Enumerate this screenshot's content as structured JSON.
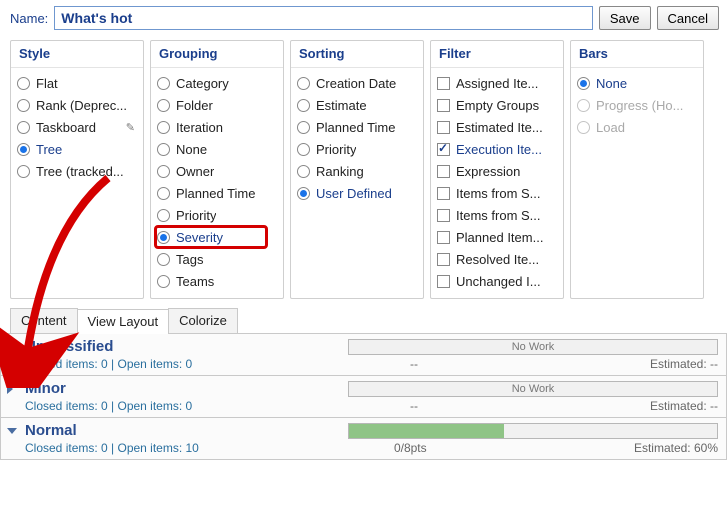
{
  "name_label": "Name:",
  "name_value": "What's hot",
  "save_label": "Save",
  "cancel_label": "Cancel",
  "cols": {
    "style": {
      "title": "Style",
      "opts": [
        "Flat",
        "Rank (Deprec...",
        "Taskboard",
        "Tree",
        "Tree (tracked..."
      ],
      "selected": 3
    },
    "grouping": {
      "title": "Grouping",
      "opts": [
        "Category",
        "Folder",
        "Iteration",
        "None",
        "Owner",
        "Planned Time",
        "Priority",
        "Severity",
        "Tags",
        "Teams"
      ],
      "selected": 7
    },
    "sorting": {
      "title": "Sorting",
      "opts": [
        "Creation Date",
        "Estimate",
        "Planned Time",
        "Priority",
        "Ranking",
        "User Defined"
      ],
      "selected": 5
    },
    "filter": {
      "title": "Filter",
      "opts": [
        "Assigned Ite...",
        "Empty Groups",
        "Estimated Ite...",
        "Execution Ite...",
        "Expression",
        "Items from S...",
        "Items from S...",
        "Planned Item...",
        "Resolved Ite...",
        "Unchanged I..."
      ],
      "checked": [
        3
      ]
    },
    "bars": {
      "title": "Bars",
      "opts": [
        "None",
        "Progress (Ho...",
        "Load"
      ],
      "selected": 0,
      "disabled": [
        1,
        2
      ]
    }
  },
  "tabs": [
    "Content",
    "View Layout",
    "Colorize"
  ],
  "active_tab": 1,
  "groups": [
    {
      "title": "Unclassified",
      "closed": 0,
      "open": 0,
      "bar_text": "No Work",
      "bar_fill": 0,
      "pts": "--",
      "est": "Estimated: --"
    },
    {
      "title": "Minor",
      "closed": 0,
      "open": 0,
      "bar_text": "No Work",
      "bar_fill": 0,
      "pts": "--",
      "est": "Estimated: --"
    },
    {
      "title": "Normal",
      "closed": 0,
      "open": 10,
      "bar_text": "",
      "bar_fill": 42,
      "pts": "0/8pts",
      "est": "Estimated: 60%"
    }
  ],
  "counts_tmpl": {
    "closed": "Closed items: ",
    "sep": " | ",
    "open": "Open items: "
  }
}
